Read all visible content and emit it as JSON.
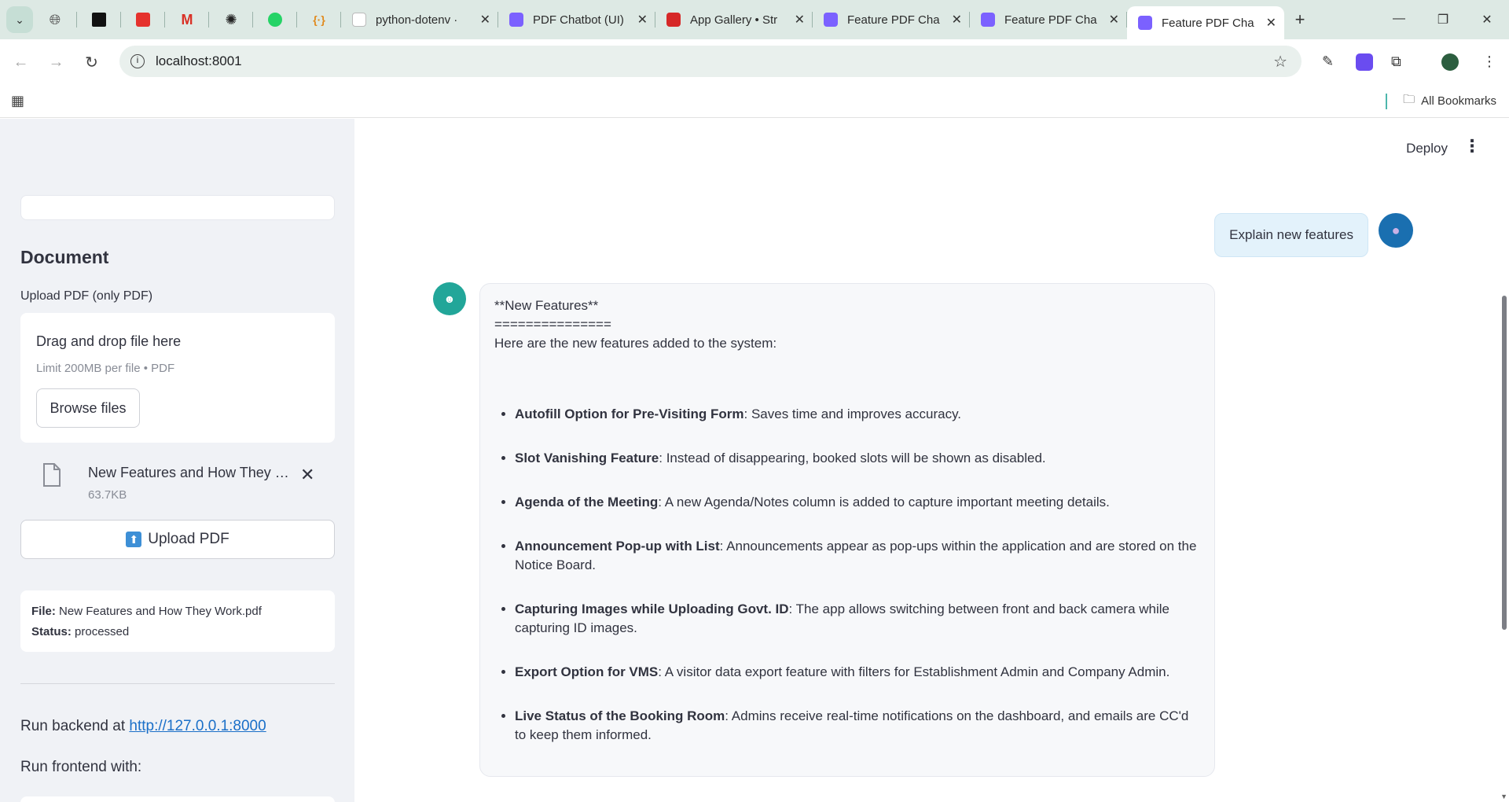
{
  "browser": {
    "tabs": [
      {
        "title": "python-dotenv ·",
        "color": "#ffffff"
      },
      {
        "title": "PDF Chatbot (UI)",
        "color": "#7b61ff"
      },
      {
        "title": "App Gallery • Str",
        "color": "#d62828"
      },
      {
        "title": "Feature PDF Cha",
        "color": "#7b61ff"
      },
      {
        "title": "Feature PDF Cha",
        "color": "#7b61ff"
      },
      {
        "title": "Feature PDF Cha",
        "color": "#7b61ff",
        "active": true
      }
    ],
    "url": "localhost:8001",
    "all_bookmarks": "All Bookmarks"
  },
  "sidebar": {
    "heading": "Document",
    "upload_label": "Upload PDF (only PDF)",
    "dropzone_title": "Drag and drop file here",
    "dropzone_limit": "Limit 200MB per file • PDF",
    "browse_label": "Browse files",
    "file_name": "New Features and How They Work.pdf",
    "file_size": "63.7KB",
    "upload_button": "Upload PDF",
    "info_file_label": "File:",
    "info_file_value": "New Features and How They Work.pdf",
    "info_status_label": "Status:",
    "info_status_value": "processed",
    "run_backend_prefix": "Run backend at",
    "run_backend_link": "http://127.0.0.1:8000",
    "run_frontend": "Run frontend with:"
  },
  "main": {
    "deploy_label": "Deploy",
    "user_message": "Explain new features",
    "bot": {
      "line1": "**New Features**",
      "line2": "===============",
      "line3": "Here are the new features added to the system:",
      "items": [
        {
          "title": "Autofill Option for Pre-Visiting Form",
          "text": ": Saves time and improves accuracy."
        },
        {
          "title": "Slot Vanishing Feature",
          "text": ": Instead of disappearing, booked slots will be shown as disabled."
        },
        {
          "title": "Agenda of the Meeting",
          "text": ": A new Agenda/Notes column is added to capture important meeting details."
        },
        {
          "title": "Announcement Pop-up with List",
          "text": ": Announcements appear as pop-ups within the application and are stored on the Notice Board."
        },
        {
          "title": "Capturing Images while Uploading Govt. ID",
          "text": ": The app allows switching between front and back camera while capturing ID images."
        },
        {
          "title": "Export Option for VMS",
          "text": ": A visitor data export feature with filters for Establishment Admin and Company Admin."
        },
        {
          "title": "Live Status of the Booking Room",
          "text": ": Admins receive real-time notifications on the dashboard, and emails are CC'd to keep them informed."
        }
      ]
    }
  },
  "colors": {
    "sidebar_bg": "#f0f2f6",
    "bot_avatar": "#22a699",
    "user_avatar": "#1a6fb0",
    "link": "#1a6fc8"
  }
}
